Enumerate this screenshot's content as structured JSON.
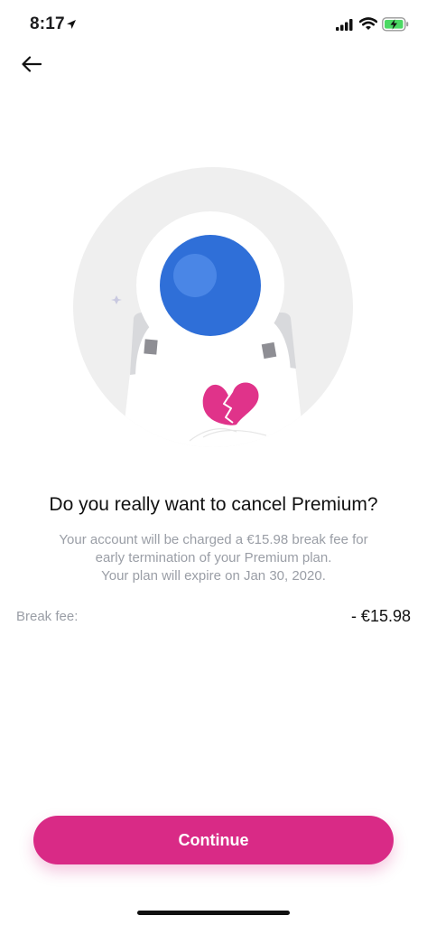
{
  "status_bar": {
    "time": "8:17",
    "icons": [
      "location-arrow-icon",
      "signal-icon",
      "wifi-icon",
      "battery-charging-icon"
    ]
  },
  "header": {
    "back_icon": "arrow-left-icon"
  },
  "illustration": {
    "name": "astronaut-broken-heart",
    "colors": {
      "circle": "#efefef",
      "helmet": "#2f6fd8",
      "heart": "#e0338a"
    }
  },
  "content": {
    "title": "Do you really want to cancel Premium?",
    "description_lines": [
      "Your account will be charged a €15.98 break fee for",
      "early termination of your Premium plan.",
      "Your plan will expire on Jan 30, 2020."
    ]
  },
  "fee": {
    "label": "Break fee:",
    "value": "- €15.98"
  },
  "actions": {
    "continue_label": "Continue",
    "accent_color": "#d92a86"
  }
}
